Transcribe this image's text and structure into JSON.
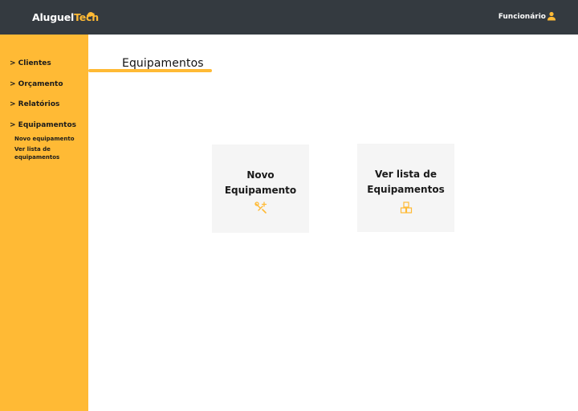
{
  "header": {
    "logo_main": "Aluguel",
    "logo_accent": "Tech",
    "user_label": "Funcionário",
    "user_icon": "user-icon",
    "accent_color": "#ffba35",
    "bar_color": "#343a40"
  },
  "sidebar": {
    "items": [
      {
        "label": "> Clientes"
      },
      {
        "label": "> Orçamento"
      },
      {
        "label": "> Relatórios"
      },
      {
        "label": "> Equipamentos"
      }
    ],
    "subitems": [
      {
        "label": "Novo equipamento"
      },
      {
        "label": "Ver lista de equipamentos"
      }
    ]
  },
  "main": {
    "title": "Equipamentos",
    "cards": [
      {
        "label": "Novo Equipamento",
        "icon": "tools-icon"
      },
      {
        "label": "Ver lista de Equipamentos",
        "icon": "boxes-icon"
      }
    ]
  }
}
